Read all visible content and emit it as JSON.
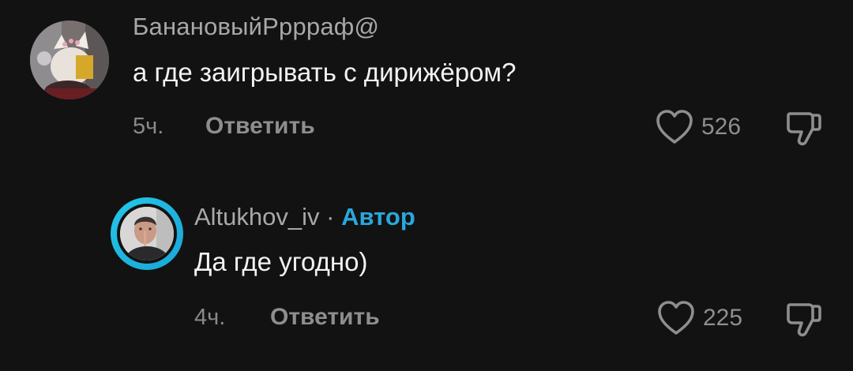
{
  "comments": [
    {
      "username": "БанановыйРррраф@",
      "text": "а где заигрывать с дирижёром?",
      "time": "5ч.",
      "reply_label": "Ответить",
      "likes": "526",
      "is_author": false
    },
    {
      "username": "Altukhov_iv",
      "separator": "·",
      "author_badge": "Автор",
      "text": "Да где угодно)",
      "time": "4ч.",
      "reply_label": "Ответить",
      "likes": "225",
      "is_author": true
    }
  ],
  "colors": {
    "background": "#121212",
    "author_badge": "#2aa7dc",
    "avatar_ring": "#25c9e9",
    "muted_text": "#8e8e8e",
    "primary_text": "#f2f2f2"
  },
  "icons": {
    "like": "heart-outline-icon",
    "dislike": "thumbs-down-outline-icon"
  }
}
